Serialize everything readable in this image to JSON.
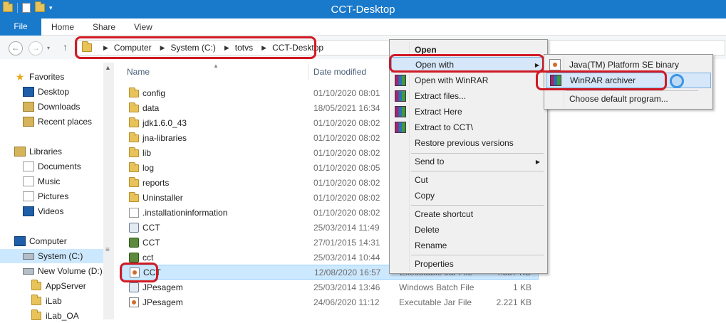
{
  "window": {
    "title": "CCT-Desktop"
  },
  "ribbon": {
    "file": "File",
    "tabs": [
      "Home",
      "Share",
      "View"
    ]
  },
  "address": {
    "crumbs": [
      "Computer",
      "System (C:)",
      "totvs",
      "CCT-Desktop"
    ]
  },
  "nav": {
    "favorites": "Favorites",
    "favorites_items": [
      "Desktop",
      "Downloads",
      "Recent places"
    ],
    "libraries": "Libraries",
    "libraries_items": [
      "Documents",
      "Music",
      "Pictures",
      "Videos"
    ],
    "computer": "Computer",
    "computer_items": [
      "System (C:)",
      "New Volume (D:)"
    ],
    "volume_items": [
      "AppServer",
      "iLab",
      "iLab_OA"
    ]
  },
  "columns": {
    "name": "Name",
    "date": "Date modified"
  },
  "files": [
    {
      "name": "config",
      "date": "01/10/2020 08:01",
      "type": "",
      "size": "",
      "icon": "folder-icon"
    },
    {
      "name": "data",
      "date": "18/05/2021 16:34",
      "type": "",
      "size": "",
      "icon": "folder-icon"
    },
    {
      "name": "jdk1.6.0_43",
      "date": "01/10/2020 08:02",
      "type": "",
      "size": "",
      "icon": "folder-icon"
    },
    {
      "name": "jna-libraries",
      "date": "01/10/2020 08:02",
      "type": "",
      "size": "",
      "icon": "folder-icon"
    },
    {
      "name": "lib",
      "date": "01/10/2020 08:02",
      "type": "",
      "size": "",
      "icon": "folder-icon"
    },
    {
      "name": "log",
      "date": "01/10/2020 08:05",
      "type": "",
      "size": "",
      "icon": "folder-icon"
    },
    {
      "name": "reports",
      "date": "01/10/2020 08:02",
      "type": "",
      "size": "",
      "icon": "folder-icon"
    },
    {
      "name": "Uninstaller",
      "date": "01/10/2020 08:02",
      "type": "",
      "size": "",
      "icon": "folder-icon"
    },
    {
      "name": ".installationinformation",
      "date": "01/10/2020 08:02",
      "type": "",
      "size": "",
      "icon": "file-icon"
    },
    {
      "name": "CCT",
      "date": "25/03/2014 11:49",
      "type": "",
      "size": "",
      "icon": "config-file-icon"
    },
    {
      "name": "CCT",
      "date": "27/01/2015 14:31",
      "type": "",
      "size": "",
      "icon": "application-icon"
    },
    {
      "name": "cct",
      "date": "25/03/2014 10:44",
      "type": "",
      "size": "",
      "icon": "application-icon"
    },
    {
      "name": "CCT",
      "date": "12/08/2020 16:57",
      "type": "Executable Jar File",
      "size": "4.357 KB",
      "icon": "jar-icon"
    },
    {
      "name": "JPesagem",
      "date": "25/03/2014 13:46",
      "type": "Windows Batch File",
      "size": "1 KB",
      "icon": "batch-file-icon"
    },
    {
      "name": "JPesagem",
      "date": "24/06/2020 11:12",
      "type": "Executable Jar File",
      "size": "2.221 KB",
      "icon": "jar-icon"
    }
  ],
  "context_menu": {
    "open": "Open",
    "open_with": "Open with",
    "open_with_winrar": "Open with WinRAR",
    "extract_files": "Extract files...",
    "extract_here": "Extract Here",
    "extract_to": "Extract to CCT\\",
    "restore": "Restore previous versions",
    "send_to": "Send to",
    "cut": "Cut",
    "copy": "Copy",
    "create_shortcut": "Create shortcut",
    "delete": "Delete",
    "rename": "Rename",
    "properties": "Properties"
  },
  "submenu": {
    "java": "Java(TM) Platform SE binary",
    "winrar": "WinRAR archiver",
    "choose": "Choose default program..."
  },
  "colors": {
    "accent": "#1979ca",
    "highlight": "#d01a24",
    "selection": "#cce8ff"
  }
}
